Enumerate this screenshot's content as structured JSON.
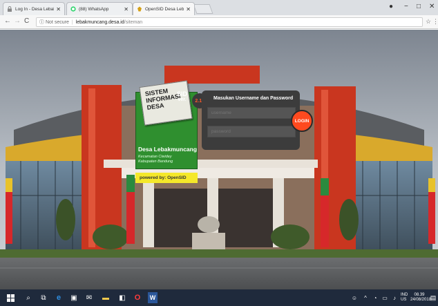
{
  "browser": {
    "tabs": [
      {
        "title": "Log In - Desa Lebakmunc",
        "active": false,
        "icon": "lock-icon"
      },
      {
        "title": "(88) WhatsApp",
        "active": false,
        "icon": "whatsapp-icon"
      },
      {
        "title": "OpenSID Desa Lebakmunc",
        "active": true,
        "icon": "garuda-icon"
      }
    ],
    "window_controls": [
      "−",
      "□",
      "✕"
    ],
    "address": {
      "security_label": "Not secure",
      "host": "lebakmuncang.desa.id",
      "path": "/siteman"
    }
  },
  "login_widget": {
    "brand_lines": [
      "SISTEM",
      "INFORMASI",
      "DESA"
    ],
    "sid_label": "SID",
    "ver_label": "ver.",
    "version": "2.11",
    "village_name": "Desa Lebakmuncang",
    "subdistrict": "Kecamatan Ciwidey",
    "regency": "Kabupaten Bandung",
    "powered_by": "powered by: OpenSID",
    "form_title": "Masukan Username dan Password",
    "username_placeholder": "username",
    "password_placeholder": "password",
    "login_button": "LOGIN"
  },
  "taskbar": {
    "icons": [
      "windows-start-icon",
      "search-icon",
      "task-view-icon",
      "edge-icon",
      "store-icon",
      "mail-icon",
      "file-explorer-icon",
      "photos-icon",
      "opera-icon",
      "word-icon"
    ],
    "language": "IND",
    "region": "US",
    "time": "08.39",
    "date": "24/08/2018"
  }
}
